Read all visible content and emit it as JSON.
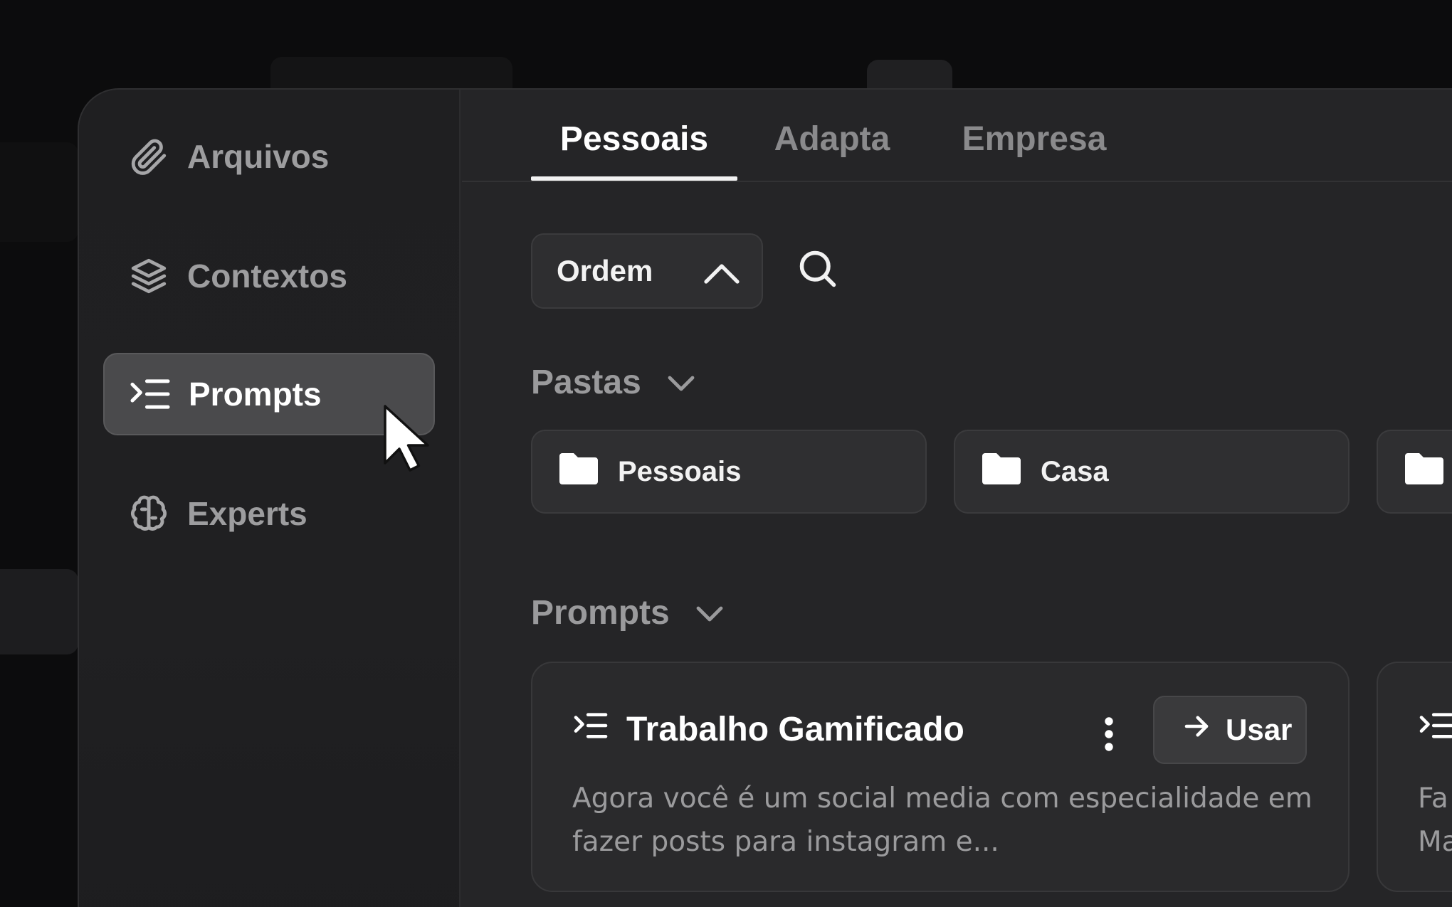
{
  "sidebar": {
    "items": [
      {
        "label": "Arquivos",
        "icon": "paperclip-icon",
        "active": false
      },
      {
        "label": "Contextos",
        "icon": "layers-icon",
        "active": false
      },
      {
        "label": "Prompts",
        "icon": "prompt-list-icon",
        "active": true
      },
      {
        "label": "Experts",
        "icon": "brain-icon",
        "active": false
      }
    ]
  },
  "tabs": [
    {
      "label": "Pessoais",
      "active": true
    },
    {
      "label": "Adapta",
      "active": false
    },
    {
      "label": "Empresa",
      "active": false
    }
  ],
  "toolbar": {
    "order_label": "Ordem",
    "order_icon": "chevron-up-icon",
    "search_icon": "search-icon"
  },
  "folders_section": {
    "title": "Pastas",
    "folders": [
      {
        "label": "Pessoais",
        "icon": "folder-icon"
      },
      {
        "label": "Casa",
        "icon": "folder-icon"
      }
    ]
  },
  "prompts_section": {
    "title": "Prompts",
    "cards": [
      {
        "title": "Trabalho Gamificado",
        "use_label": "Usar",
        "description": "Agora você é um social media com especialidade em fazer posts para instagram e..."
      },
      {
        "title": "",
        "use_label": "",
        "description_line1": "Fa",
        "description_line2": "Ma"
      }
    ]
  },
  "colors": {
    "background": "#0c0c0d",
    "panel": "#252527",
    "sidebar": "#1f1f21",
    "active_item": "#4a4a4c",
    "text_primary": "#ffffff",
    "text_muted": "#9d9d9f"
  }
}
